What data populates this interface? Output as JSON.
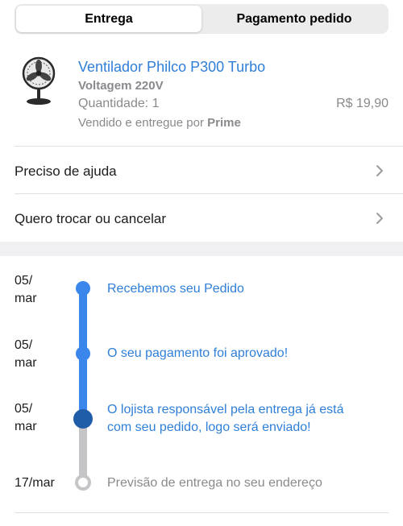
{
  "tabs": [
    {
      "label": "Entrega",
      "active": true
    },
    {
      "label": "Pagamento pedido",
      "active": false
    }
  ],
  "product": {
    "image_icon": "fan-icon",
    "title": "Ventilador Philco P300 Turbo",
    "variant": "Voltagem 220V",
    "quantity": "Quantidade: 1",
    "price": "R$ 19,90",
    "seller_prefix": "Vendido e entregue por",
    "seller_name": "Prime"
  },
  "actions": [
    {
      "label": "Preciso de ajuda",
      "icon": "chevron-right-icon"
    },
    {
      "label": "Quero trocar ou cancelar",
      "icon": "chevron-right-icon"
    }
  ],
  "timeline": [
    {
      "date_day": "05/",
      "date_month": "mar",
      "text_1": "Recebemos seu Pedido",
      "text_2": "",
      "status": "done"
    },
    {
      "date_day": "05/",
      "date_month": "mar",
      "text_1": "O seu pagamento foi aprovado!",
      "text_2": "",
      "status": "done"
    },
    {
      "date_day": "05/",
      "date_month": "mar",
      "text_1": "O lojista responsável pela entrega já está",
      "text_2": "com seu pedido, logo será enviado!",
      "status": "current"
    },
    {
      "date_day": "17/mar",
      "date_month": "",
      "text_1": "Previsão de entrega no seu endereço",
      "text_2": "",
      "status": "pending"
    }
  ],
  "colors": {
    "accent": "#2f7fd8",
    "track_done": "#3a86ea",
    "track_current_dot": "#1f5da8",
    "track_pending": "#c5c5c8",
    "muted_text": "#8a8a8e"
  }
}
